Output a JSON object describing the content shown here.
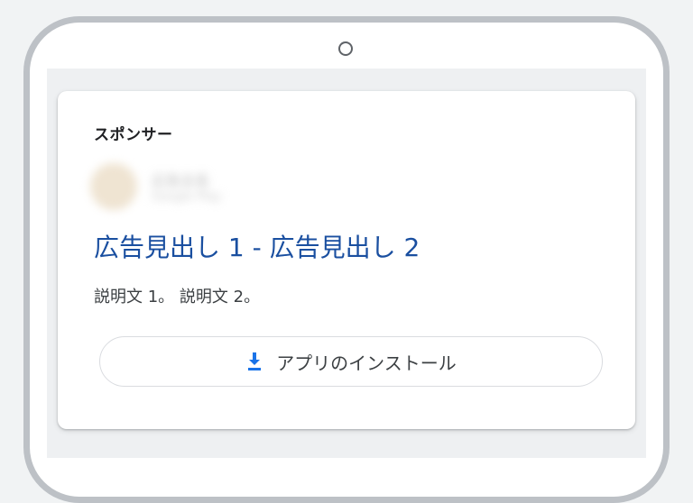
{
  "ad": {
    "sponsor_label": "スポンサー",
    "advertiser_name": "広告主名",
    "advertiser_url": "Google Play",
    "headline": "広告見出し 1 - 広告見出し 2",
    "description": "説明文 1。 説明文 2。",
    "install_button_label": "アプリのインストール",
    "install_icon": "download-icon"
  },
  "colors": {
    "headline": "#1a4fa0",
    "install_icon": "#1a73e8",
    "device_frame": "#bdc1c6"
  }
}
